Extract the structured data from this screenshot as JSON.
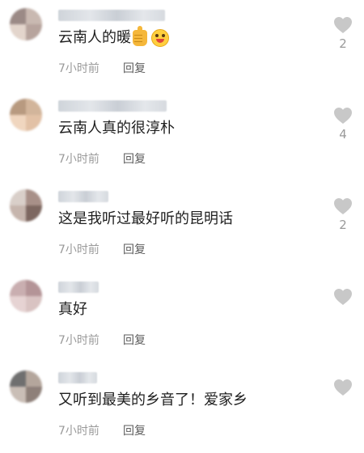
{
  "comments": [
    {
      "comment_text": "云南人的暖",
      "emojis": [
        "thumbs-up-icon",
        "wink-face-icon"
      ],
      "time": "7小时前",
      "reply_label": "回复",
      "likes": "2"
    },
    {
      "comment_text": "云南人真的很淳朴",
      "emojis": [],
      "time": "7小时前",
      "reply_label": "回复",
      "likes": "4"
    },
    {
      "comment_text": "这是我听过最好听的昆明话",
      "emojis": [],
      "time": "7小时前",
      "reply_label": "回复",
      "likes": "2"
    },
    {
      "comment_text": "真好",
      "emojis": [],
      "time": "7小时前",
      "reply_label": "回复",
      "likes": ""
    },
    {
      "comment_text": "又听到最美的乡音了！爱家乡",
      "emojis": [],
      "time": "7小时前",
      "reply_label": "回复",
      "likes": ""
    }
  ],
  "colors": {
    "text": "#1f1f1f",
    "meta": "#9a9a9a",
    "heart": "#c8c8c8"
  },
  "icons": {
    "like": "heart-icon",
    "avatar": "blurred-avatar"
  }
}
